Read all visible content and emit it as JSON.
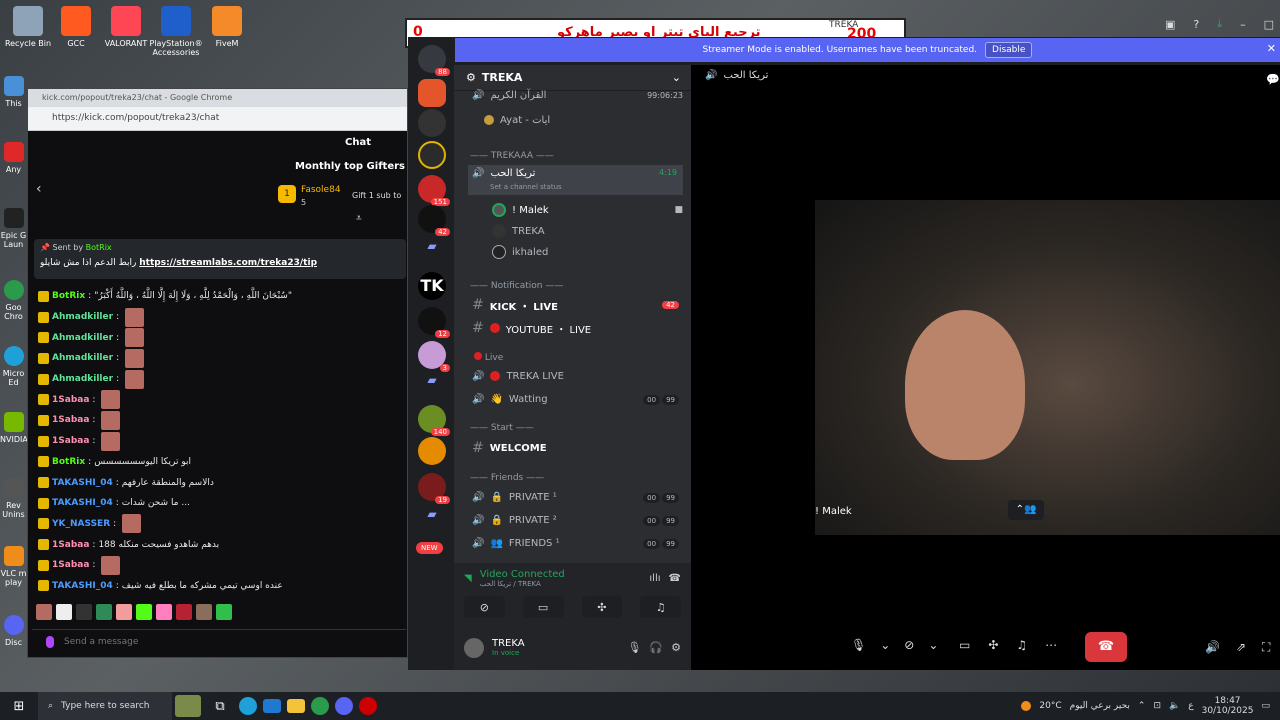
{
  "desktop": {
    "icons": [
      {
        "label": "Recycle Bin",
        "color": "#8fa3b8"
      },
      {
        "label": "GCC",
        "color": "#ff5a1f"
      },
      {
        "label": "VALORANT",
        "color": "#ff4655"
      },
      {
        "label": "PlayStation® Accessories",
        "color": "#1e5fcc"
      },
      {
        "label": "FiveM",
        "color": "#f48a2a"
      }
    ],
    "left_labels": [
      "This",
      "Any",
      "Epic G Laun",
      "Goo Chro",
      "Micro Ed",
      "NVIDIA",
      "Rev Unins",
      "VLC m play",
      "Disc"
    ]
  },
  "overlay": {
    "left_number": "0",
    "arabic": "ترجيع الباي تيتر او بصير ماهركو",
    "right_number": "200",
    "tag": "TREKA"
  },
  "banner": {
    "text": "Streamer Mode is enabled. Usernames have been truncated.",
    "button": "Disable"
  },
  "chrome": {
    "title": "kick.com/popout/treka23/chat - Google Chrome",
    "url": "https://kick.com/popout/treka23/chat",
    "chat_header": "Chat",
    "gifters_title": "Monthly top Gifters",
    "gifter_rank": "1",
    "gifter_name": "Fasole84",
    "gifter_count": "5",
    "gift_text": "Gift 1 sub to",
    "pinned_by_label": "Sent by",
    "pinned_by_user": "BotRix",
    "pinned_text": "رابط الدعم اذا مش شايلو",
    "pinned_link": "https://streamlabs.com/treka23/tip",
    "messages": [
      {
        "user": "BotRix",
        "color": "#53fc18",
        "text": "\"سُبْحَانَ اللَّهِ ، وَالْحَمْدُ لِلَّهِ ، وَلَا إِلَهَ إِلَّا اللَّهُ ، وَاللَّهُ أَكْبَرُ\"",
        "emotes": 0
      },
      {
        "user": "Ahmadkiller",
        "color": "#5fe39a",
        "text": "",
        "emotes": 1
      },
      {
        "user": "Ahmadkiller",
        "color": "#5fe39a",
        "text": "",
        "emotes": 1
      },
      {
        "user": "Ahmadkiller",
        "color": "#5fe39a",
        "text": "",
        "emotes": 1
      },
      {
        "user": "Ahmadkiller",
        "color": "#5fe39a",
        "text": "",
        "emotes": 1
      },
      {
        "user": "1Sabaa",
        "color": "#ff8fb1",
        "text": "",
        "emotes": 1
      },
      {
        "user": "1Sabaa",
        "color": "#ff8fb1",
        "text": "",
        "emotes": 1
      },
      {
        "user": "1Sabaa",
        "color": "#ff8fb1",
        "text": "",
        "emotes": 1
      },
      {
        "user": "BotRix",
        "color": "#53fc18",
        "text": "ابو تريكا اليوسسسسسس",
        "emotes": 0
      },
      {
        "user": "TAKASHI_04",
        "color": "#4a9cff",
        "text": "دالاسم والمنطقة عارفهم",
        "emotes": 0
      },
      {
        "user": "TAKASHI_04",
        "color": "#4a9cff",
        "text": "ما شحن شدات ...",
        "emotes": 0
      },
      {
        "user": "YK_NASSER",
        "color": "#4a9cff",
        "text": "",
        "emotes": 1
      },
      {
        "user": "1Sabaa",
        "color": "#ff8fb1",
        "text": "188 بدهم شاهدو فسيحت منكله",
        "emotes": 0
      },
      {
        "user": "1Sabaa",
        "color": "#ff8fb1",
        "text": "",
        "emotes": 1
      },
      {
        "user": "TAKASHI_04",
        "color": "#4a9cff",
        "text": "عنده اوسي تيمي مشركه ما بطلع فيه شيف",
        "emotes": 0
      }
    ],
    "send_placeholder": "Send a message"
  },
  "discord": {
    "guild_badges": [
      "88",
      "151",
      "42",
      "12",
      "3",
      "140",
      "19"
    ],
    "new_label": "NEW",
    "server_name": "TREKA",
    "channels": {
      "quran": "القرآن الكريم",
      "quran_time": "99:06:23",
      "ayat": "Ayat - ايات",
      "cat_trekaaa": "TREKAAA",
      "voice_channel": "تريكا الحب",
      "voice_time": "4:19",
      "set_status": "Set a channel status",
      "members": [
        "! Malek",
        "TREKA",
        "ikhaled"
      ],
      "cat_notification": "Notification",
      "kick_live": "KICK ・ LIVE",
      "kick_badge": "42",
      "youtube_live": "YOUTUBE ・ LIVE",
      "cat_live": "Live",
      "treka_live": "TREKA LIVE",
      "watting": "Watting",
      "cat_start": "Start",
      "welcome": "WELCOME",
      "cat_friends": "Friends",
      "private1": "PRIVATE ¹",
      "private2": "PRIVATE ²",
      "friends1": "FRIENDS ¹",
      "pill_00": "00",
      "pill_99": "99"
    },
    "voice_status": {
      "title": "Video Connected",
      "sub": "تريكا الحب / TREKA"
    },
    "user": {
      "name": "TREKA",
      "status": "In voice"
    },
    "stage": {
      "channel_title": "تريكا الحب",
      "participant": "! Malek"
    }
  },
  "taskbar": {
    "search_placeholder": "Type here to search",
    "weather": "20°C",
    "weather_text": "بحير برعي اليوم",
    "time": "18:47",
    "date": "30/10/2025",
    "lang": "ع"
  }
}
